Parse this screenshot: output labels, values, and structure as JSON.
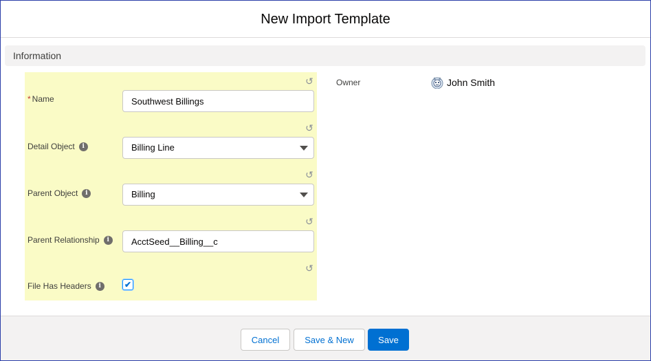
{
  "modal": {
    "title": "New Import Template"
  },
  "section": {
    "title": "Information"
  },
  "fields": {
    "name": {
      "required_mark": "*",
      "label": "Name",
      "value": "Southwest Billings"
    },
    "detail_object": {
      "label": "Detail Object",
      "value": "Billing Line"
    },
    "parent_object": {
      "label": "Parent Object",
      "value": "Billing"
    },
    "parent_relationship": {
      "label": "Parent Relationship",
      "value": "AcctSeed__Billing__c"
    },
    "file_has_headers": {
      "label": "File Has Headers",
      "checked": true,
      "check_glyph": "✔"
    }
  },
  "owner": {
    "label": "Owner",
    "name": "John Smith"
  },
  "icons": {
    "undo": "↺",
    "info": "i"
  },
  "footer": {
    "cancel": "Cancel",
    "save_new": "Save & New",
    "save": "Save"
  },
  "colors": {
    "brand": "#0070d2",
    "edited_highlight": "#fafbc6",
    "required": "#c23934"
  }
}
